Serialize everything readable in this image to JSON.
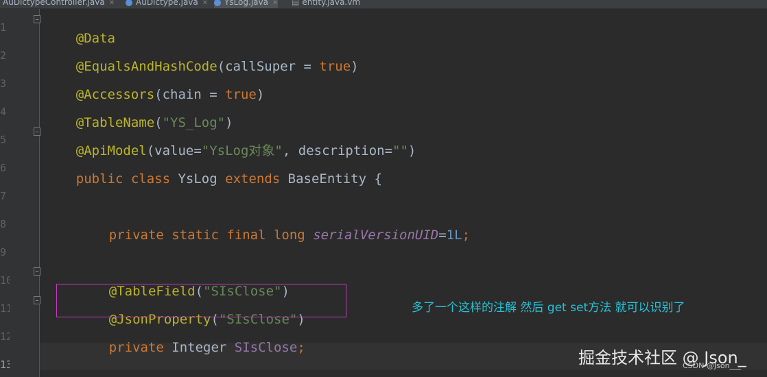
{
  "tabs": [
    {
      "label": "AuDictypeController.java"
    },
    {
      "label": "AuDictype.java"
    },
    {
      "label": "YsLog.java"
    },
    {
      "label": "entity.java.vm"
    }
  ],
  "line_numbers": [
    "1",
    "2",
    "3",
    "4",
    "5",
    "6",
    "7",
    "8",
    "9",
    "10",
    "11",
    "12",
    "13"
  ],
  "code": {
    "l1": {
      "ann": "@Data"
    },
    "l2": {
      "ann": "@EqualsAndHashCode",
      "p1": "(callSuper = ",
      "kw": "true",
      "p2": ")"
    },
    "l3": {
      "ann": "@Accessors",
      "p1": "(chain = ",
      "kw": "true",
      "p2": ")"
    },
    "l4": {
      "ann": "@TableName",
      "p1": "(",
      "str": "\"YS_Log\"",
      "p2": ")"
    },
    "l5": {
      "ann": "@ApiModel",
      "p1": "(value=",
      "str1": "\"YsLog对象\"",
      "p2": ", description=",
      "str2": "\"\"",
      "p3": ")"
    },
    "l6": {
      "kw1": "public class ",
      "name": "YsLog ",
      "kw2": "extends ",
      "base": "BaseEntity {"
    },
    "l8": {
      "kw": "private static final long ",
      "field": "serialVersionUID",
      "eq": "=",
      "num": "1L",
      "semi": ";"
    },
    "l10": {
      "ann": "@TableField",
      "p1": "(",
      "str": "\"SIsClose\"",
      "p2": ")"
    },
    "l11": {
      "ann": "@JsonProperty",
      "p1": "(",
      "str": "\"SIsClose\"",
      "p2": ")"
    },
    "l12": {
      "kw": "private ",
      "type": "Integer ",
      "field": "SIsClose",
      "semi": ";"
    }
  },
  "note": "多了一个这样的注解  然后 get set方法 就可以识别了",
  "watermark": "掘金技术社区 @ Json_",
  "watermark_small": "CSDN @Json___",
  "colors": {
    "background": "#2b2b2b",
    "annotation": "#bbb529",
    "keyword": "#cc7832",
    "string": "#6a8759",
    "number": "#6897bb",
    "field": "#9876aa",
    "highlight_box": "#c53dc0",
    "note": "#27c1d6"
  }
}
